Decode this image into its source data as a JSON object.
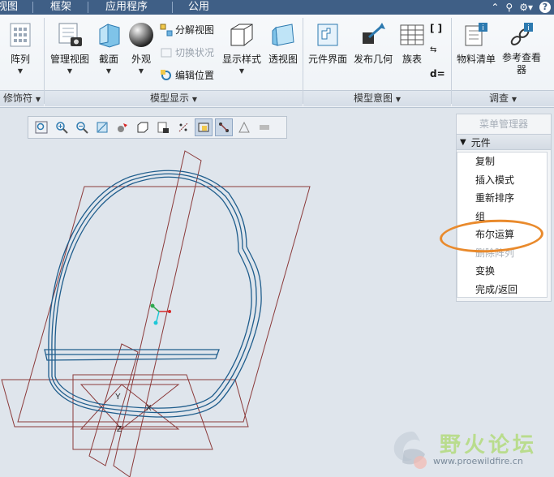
{
  "tabs": [
    "视图",
    "框架",
    "应用程序",
    "公用"
  ],
  "tab_right_icons": [
    "chevron-up-icon",
    "search-icon",
    "settings-icon",
    "help-icon"
  ],
  "ribbon": {
    "array": "阵列",
    "manage_views": "管理视图",
    "section": "截面",
    "appearance": "外观",
    "explode_view": "分解视图",
    "toggle_status": "切换状况",
    "edit_position": "编辑位置",
    "display_style": "显示样式",
    "perspective": "透视图",
    "component_interface": "元件界面",
    "publish_geometry": "发布几何",
    "family_table": "族表",
    "bom": "物料清单",
    "reference_viewer": "参考查看器",
    "groups": {
      "modifiers": "修饰符",
      "model_display": "模型显示",
      "model_intent": "模型意图",
      "investigate": "调查"
    }
  },
  "menu_manager": {
    "title": "菜单管理器",
    "header": "元件",
    "items": [
      {
        "label": "复制",
        "enabled": true
      },
      {
        "label": "插入模式",
        "enabled": true
      },
      {
        "label": "重新排序",
        "enabled": true
      },
      {
        "label": "组",
        "enabled": true
      },
      {
        "label": "布尔运算",
        "enabled": true
      },
      {
        "label": "删除阵列",
        "enabled": false
      },
      {
        "label": "变换",
        "enabled": true
      },
      {
        "label": "完成/返回",
        "enabled": true
      }
    ]
  },
  "datum_labels": {
    "x": "X",
    "y": "Y",
    "z": "Z"
  },
  "watermark": {
    "title": "野火论坛",
    "url": "www.proewildfire.cn"
  },
  "colors": {
    "tabbar": "#3f5f86",
    "highlight_ring": "#e98a2c",
    "datum_plane": "#8b3a3a",
    "model_edge": "#1f5d8c"
  }
}
